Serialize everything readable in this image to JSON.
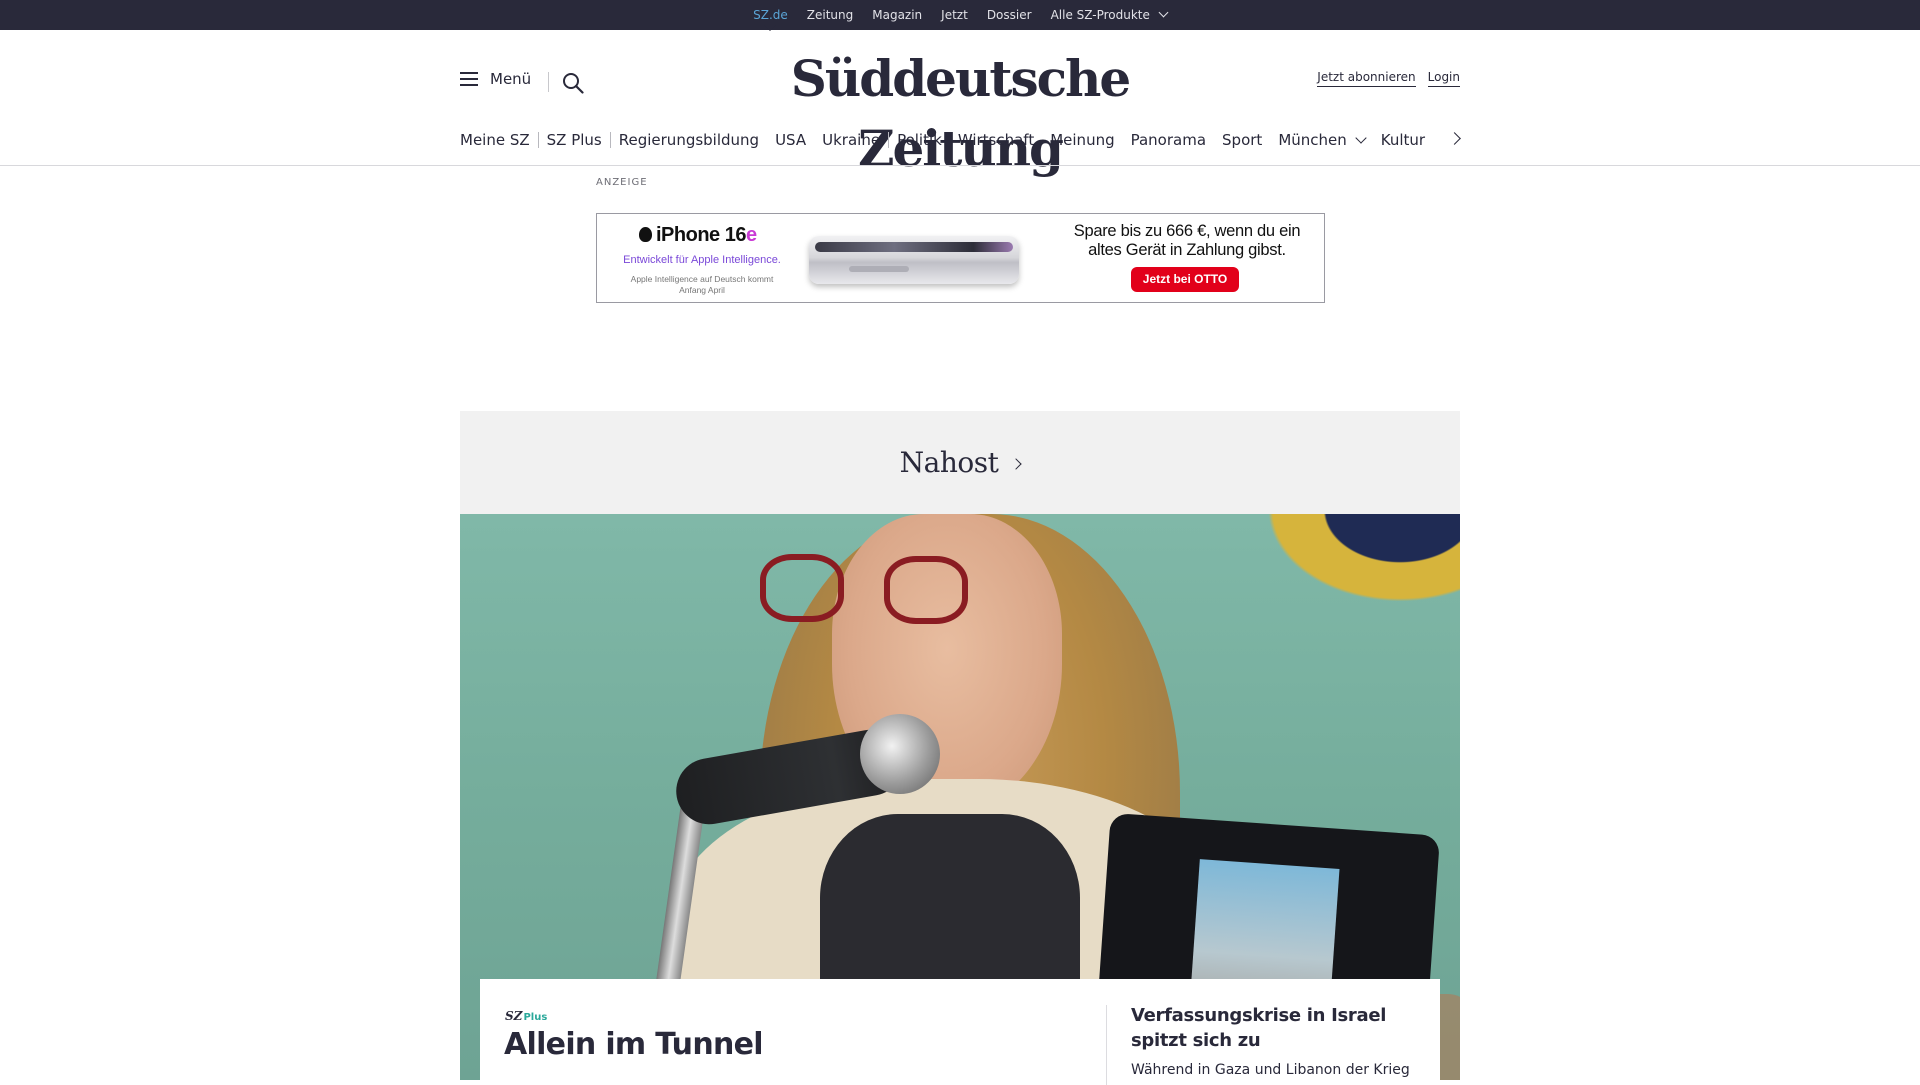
{
  "topbar": {
    "links": [
      "SZ.de",
      "Zeitung",
      "Magazin",
      "Jetzt",
      "Dossier",
      "Alle SZ-Produkte"
    ]
  },
  "header": {
    "menu_label": "Menü",
    "logo": "Süddeutsche Zeitung",
    "subscribe_label": "Jetzt abonnieren",
    "login_label": "Login"
  },
  "nav": {
    "items": [
      "Meine SZ",
      "SZ Plus",
      "Regierungsbildung",
      "USA",
      "Ukraine",
      "Politik",
      "Wirtschaft",
      "Meinung",
      "Panorama",
      "Sport",
      "München",
      "Kultur"
    ]
  },
  "ad": {
    "label": "ANZEIGE",
    "product": "iPhone 16",
    "product_suffix": "e",
    "tagline": "Entwickelt für Apple Intelligence.",
    "note": "Apple Intelligence auf Deutsch kommt Anfang April",
    "promo": "Spare bis zu 666 €, wenn du ein altes Gerät in Zahlung gibst.",
    "cta": "Jetzt bei OTTO"
  },
  "section": {
    "title": "Nahost"
  },
  "article": {
    "badge": "SZ",
    "badge_plus": "Plus",
    "headline": "Allein im Tunnel",
    "side_headline": "Verfassungskrise in Israel spitzt sich zu",
    "side_text": "Während in Gaza und Libanon der Krieg"
  },
  "colors": {
    "topbar_bg": "#29293a",
    "active_link": "#5aa4d6",
    "section_bg": "#f1f1f1",
    "plus_accent": "#2aa89a",
    "otto_red": "#e2001a"
  }
}
